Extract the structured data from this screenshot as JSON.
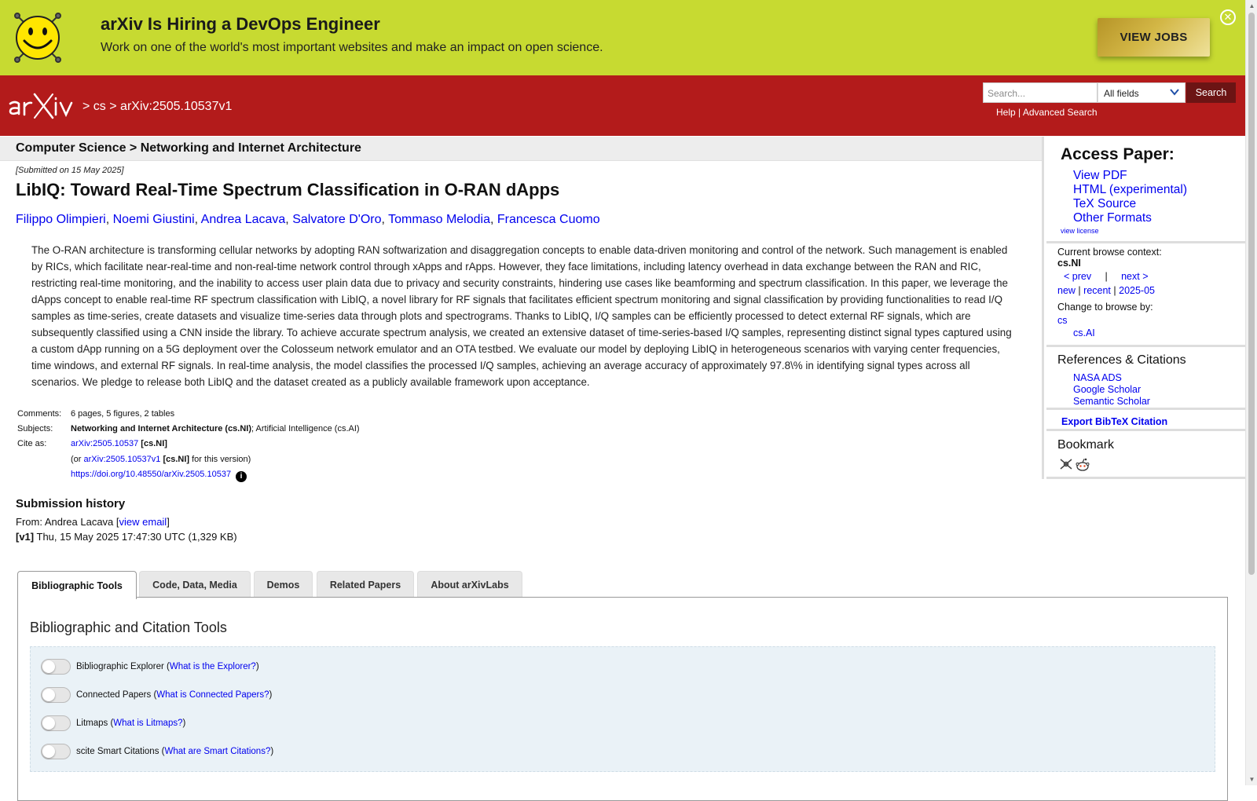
{
  "banner": {
    "title": "arXiv Is Hiring a DevOps Engineer",
    "text": "Work on one of the world's most important websites and make an impact on open science.",
    "button": "VIEW JOBS",
    "close_glyph": "✕"
  },
  "header": {
    "crumb_sep1": ">",
    "crumb_cs": "cs",
    "crumb_sep2": ">",
    "crumb_id": "arXiv:2505.10537v1",
    "search_placeholder": "Search...",
    "search_field": "All fields",
    "search_button": "Search",
    "help": "Help",
    "link_sep": "|",
    "advanced": "Advanced Search"
  },
  "subheader": "Computer Science > Networking and Internet Architecture",
  "paper": {
    "dateline": "[Submitted on 15 May 2025]",
    "title": "LibIQ: Toward Real-Time Spectrum Classification in O-RAN dApps",
    "authors": [
      "Filippo Olimpieri",
      "Noemi Giustini",
      "Andrea Lacava",
      "Salvatore D'Oro",
      "Tommaso Melodia",
      "Francesca Cuomo"
    ],
    "author_sep": ",",
    "abstract": "The O-RAN architecture is transforming cellular networks by adopting RAN softwarization and disaggregation concepts to enable data-driven monitoring and control of the network. Such management is enabled by RICs, which facilitate near-real-time and non-real-time network control through xApps and rApps. However, they face limitations, including latency overhead in data exchange between the RAN and RIC, restricting real-time monitoring, and the inability to access user plain data due to privacy and security constraints, hindering use cases like beamforming and spectrum classification. In this paper, we leverage the dApps concept to enable real-time RF spectrum classification with LibIQ, a novel library for RF signals that facilitates efficient spectrum monitoring and signal classification by providing functionalities to read I/Q samples as time-series, create datasets and visualize time-series data through plots and spectrograms. Thanks to LibIQ, I/Q samples can be efficiently processed to detect external RF signals, which are subsequently classified using a CNN inside the library. To achieve accurate spectrum analysis, we created an extensive dataset of time-series-based I/Q samples, representing distinct signal types captured using a custom dApp running on a 5G deployment over the Colosseum network emulator and an OTA testbed. We evaluate our model by deploying LibIQ in heterogeneous scenarios with varying center frequencies, time windows, and external RF signals. In real-time analysis, the model classifies the processed I/Q samples, achieving an average accuracy of approximately 97.8\\% in identifying signal types across all scenarios. We pledge to release both LibIQ and the dataset created as a publicly available framework upon acceptance."
  },
  "metadata": {
    "comments_label": "Comments:",
    "comments": "6 pages, 5 figures, 2 tables",
    "subjects_label": "Subjects:",
    "subjects_primary": "Networking and Internet Architecture (cs.NI)",
    "subjects_rest": "; Artificial Intelligence (cs.AI)",
    "cite_label": "Cite as:",
    "cite_id": "arXiv:2505.10537",
    "cite_cat": "[cs.NI]",
    "or_prefix": "(or",
    "cite_version": "arXiv:2505.10537v1",
    "version_suffix": "for this version)",
    "doi": "https://doi.org/10.48550/arXiv.2505.10537",
    "info_glyph": "i"
  },
  "history": {
    "title": "Submission history",
    "from_prefix": "From: Andrea Lacava [",
    "view_email": "view email",
    "from_suffix": "]",
    "v1_label": "[v1]",
    "v1_text": "Thu, 15 May 2025 17:47:30 UTC (1,329 KB)"
  },
  "tabs": [
    "Bibliographic Tools",
    "Code, Data, Media",
    "Demos",
    "Related Papers",
    "About arXivLabs"
  ],
  "tools": {
    "heading": "Bibliographic and Citation Tools",
    "items": [
      {
        "label": "Bibliographic Explorer (",
        "link": "What is the Explorer?",
        "close": ")"
      },
      {
        "label": "Connected Papers (",
        "link": "What is Connected Papers?",
        "close": ")"
      },
      {
        "label": "Litmaps (",
        "link": "What is Litmaps?",
        "close": ")"
      },
      {
        "label": "scite Smart Citations (",
        "link": "What are Smart Citations?",
        "close": ")"
      }
    ]
  },
  "sidebar": {
    "access_title": "Access Paper:",
    "access_links": [
      "View PDF",
      "HTML (experimental)",
      "TeX Source",
      "Other Formats"
    ],
    "view_license": "view license",
    "context_label": "Current browse context:",
    "context_value": "cs.NI",
    "prev": "< prev",
    "nav_sep": "|",
    "next": "next >",
    "new": "new",
    "recent": "recent",
    "month": "2025-05",
    "change_label": "Change to browse by:",
    "browse_cs": "cs",
    "browse_csai": "cs.AI",
    "refs_title": "References & Citations",
    "refs_links": [
      "NASA ADS",
      "Google Scholar",
      "Semantic Scholar"
    ],
    "export": "Export BibTeX Citation",
    "bookmark_title": "Bookmark"
  },
  "colors": {
    "banner_bg": "#c7da31",
    "header_red": "#b31b1b",
    "search_button": "#6c1414",
    "link": "#0000ee"
  },
  "icons": [
    "smiley-icon",
    "arxiv-logo",
    "chevron-down-icon",
    "close-icon",
    "info-icon",
    "bibsonomy-icon",
    "reddit-icon"
  ]
}
